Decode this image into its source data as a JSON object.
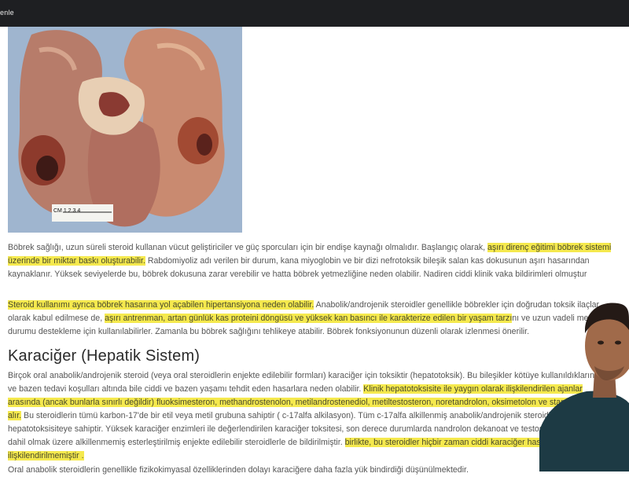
{
  "topbar": {
    "label": "enle"
  },
  "figure": {
    "scale_label": "CM 1 2 3 4"
  },
  "paragraph1": {
    "t1": "Böbrek sağlığı, uzun süreli steroid kullanan vücut geliştiriciler ve güç sporcuları için bir endişe kaynağı olmalıdır. Başlangıç olarak, ",
    "h1": "aşırı direnç eğitimi böbrek sistemi üzerinde bir miktar baskı oluşturabilir.",
    "t2": " Rabdomiyoliz adı verilen bir durum, kana miyoglobin ve bir dizi nefrotoksik bileşik salan kas dokusunun aşırı hasarından kaynaklanır. Yüksek seviyelerde bu, böbrek dokusuna zarar verebilir ve hatta böbrek yetmezliğine neden olabilir. Nadiren ciddi klinik vaka bildirimleri olmuştur"
  },
  "paragraph2": {
    "h1": "Steroid kullanımı ayrıca böbrek hasarına yol açabilen hipertansiyona neden olabilir.",
    "t1": " Anabolik/androjenik steroidler genellikle böbrekler için doğrudan toksik ilaçlar olarak kabul edilmese de, ",
    "h2": "aşırı antrenman, artan günlük kas proteini döngüsü ve yüksek kan basıncı ile karakterize edilen bir yaşam tarzı",
    "t2": "nı ve uzun vadeli metabolik durumu destekleme için kullanılabilirler. Zamanla bu böbrek sağlığını tehlikeye atabilir. Böbrek fonksiyonunun düzenli olarak izlenmesi önerilir."
  },
  "heading": "Karaciğer (Hepatik Sistem)",
  "paragraph3": {
    "t1": "Birçok oral anabolik/androjenik steroid (veya oral steroidlerin enjekte edilebilir formları) karaciğer için toksiktir (hepatotoksik). Bu bileşikler kötüye kullanıldıklarında ve bazen tedavi koşulları altında bile ciddi ve bazen yaşamı tehdit eden hasarlara neden olabilir. ",
    "h1": "Klinik hepatotoksisite ile yaygın olarak ilişkilendirilen ajanlar arasında (ancak bunlarla sınırlı değildir) fluoksimesteron, methandrostenolon, metilandrostenediol, metiltestosteron, noretandrolon, oksimetolon ve stanozolol yer alır.",
    "t2": " Bu steroidlerin tümü karbon-17'de bir etil veya metil grubuna sahiptir ( c-17alfa alkilasyon). Tüm c-17alfa alkillenmiş anabolik/androjenik steroidler, bir düzeyde hepatotoksisiteye sahiptir. Yüksek karaciğer enzimleri ile değerlendirilen karaciğer toksitesi, son derece durumlarda nandrolon dekanoat ve testosteron enanthate dahil olmak üzere alkillenmemiş esterleştirilmiş enjekte edilebilir steroidlerle de bildirilmiştir. ",
    "h2": "birlikte, bu steroidler hiçbir zaman ciddi karaciğer hasarı ile ilişkilendirilmemiştir ."
  },
  "paragraph4": {
    "t1": "Oral anabolik steroidlerin genellikle fizikokimyasal özelliklerinden dolayı karaciğere daha fazla yük bindirdiği düşünülmektedir."
  }
}
